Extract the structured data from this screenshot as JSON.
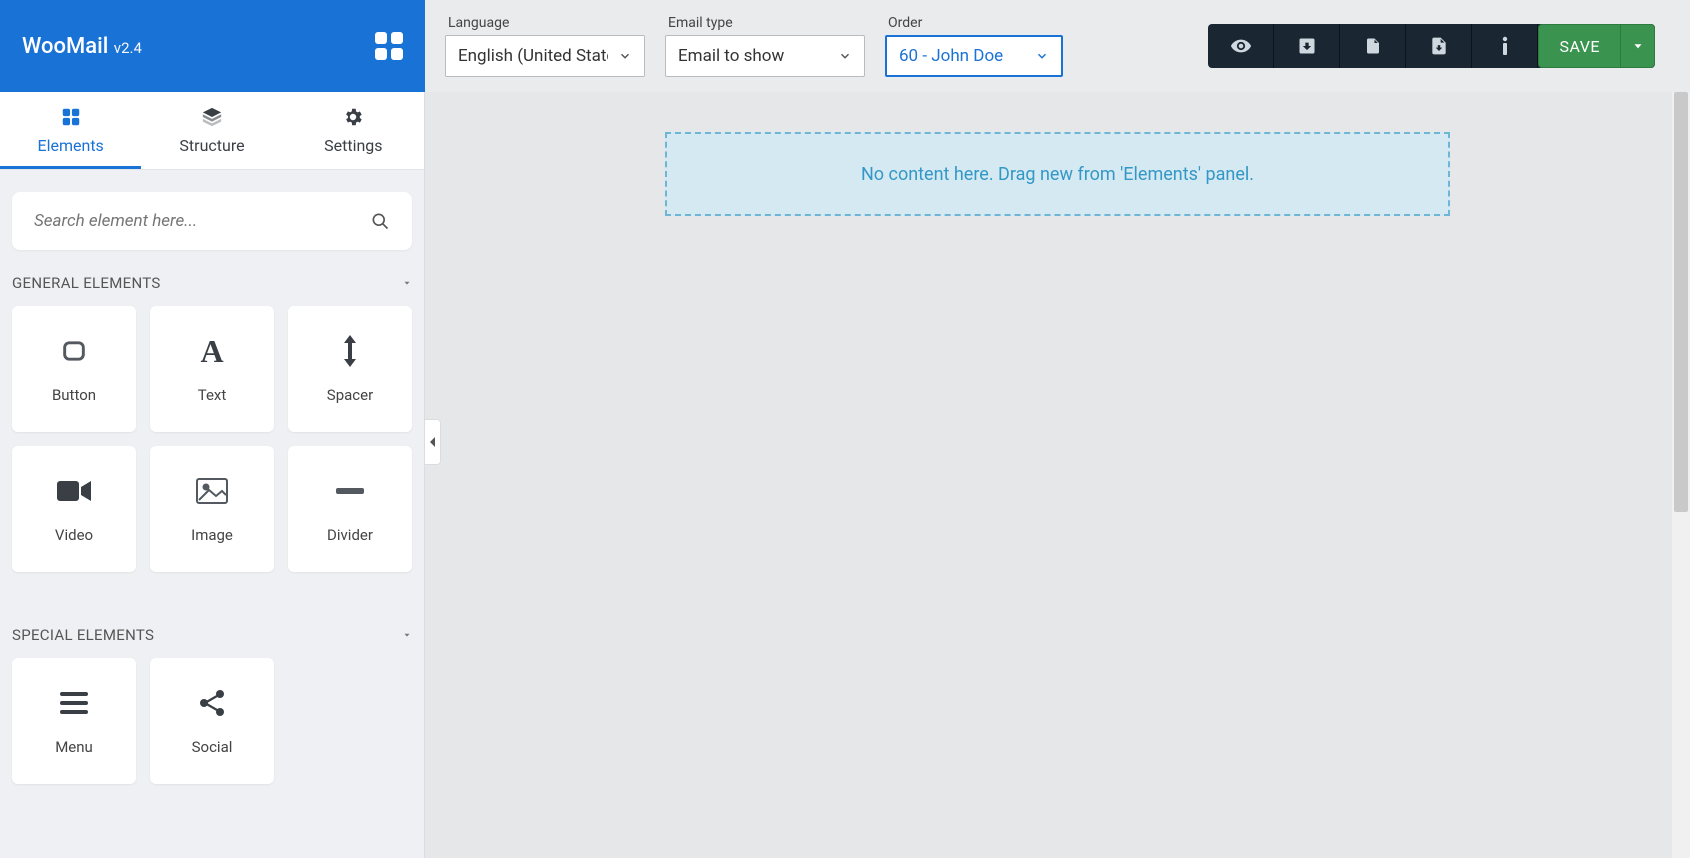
{
  "brand": {
    "name": "WooMail",
    "version": "v2.4"
  },
  "toolbar": {
    "language": {
      "label": "Language",
      "value": "English (United States)"
    },
    "emailType": {
      "label": "Email type",
      "value": "Email to show"
    },
    "order": {
      "label": "Order",
      "value": "60 - John Doe"
    },
    "save": "SAVE"
  },
  "tabs": {
    "elements": "Elements",
    "structure": "Structure",
    "settings": "Settings"
  },
  "search": {
    "placeholder": "Search element here..."
  },
  "sections": {
    "general": "GENERAL ELEMENTS",
    "special": "SPECIAL ELEMENTS"
  },
  "generalElements": {
    "button": "Button",
    "text": "Text",
    "spacer": "Spacer",
    "video": "Video",
    "image": "Image",
    "divider": "Divider"
  },
  "specialElements": {
    "menu": "Menu",
    "social": "Social"
  },
  "canvas": {
    "empty": "No content here. Drag new from 'Elements' panel."
  }
}
